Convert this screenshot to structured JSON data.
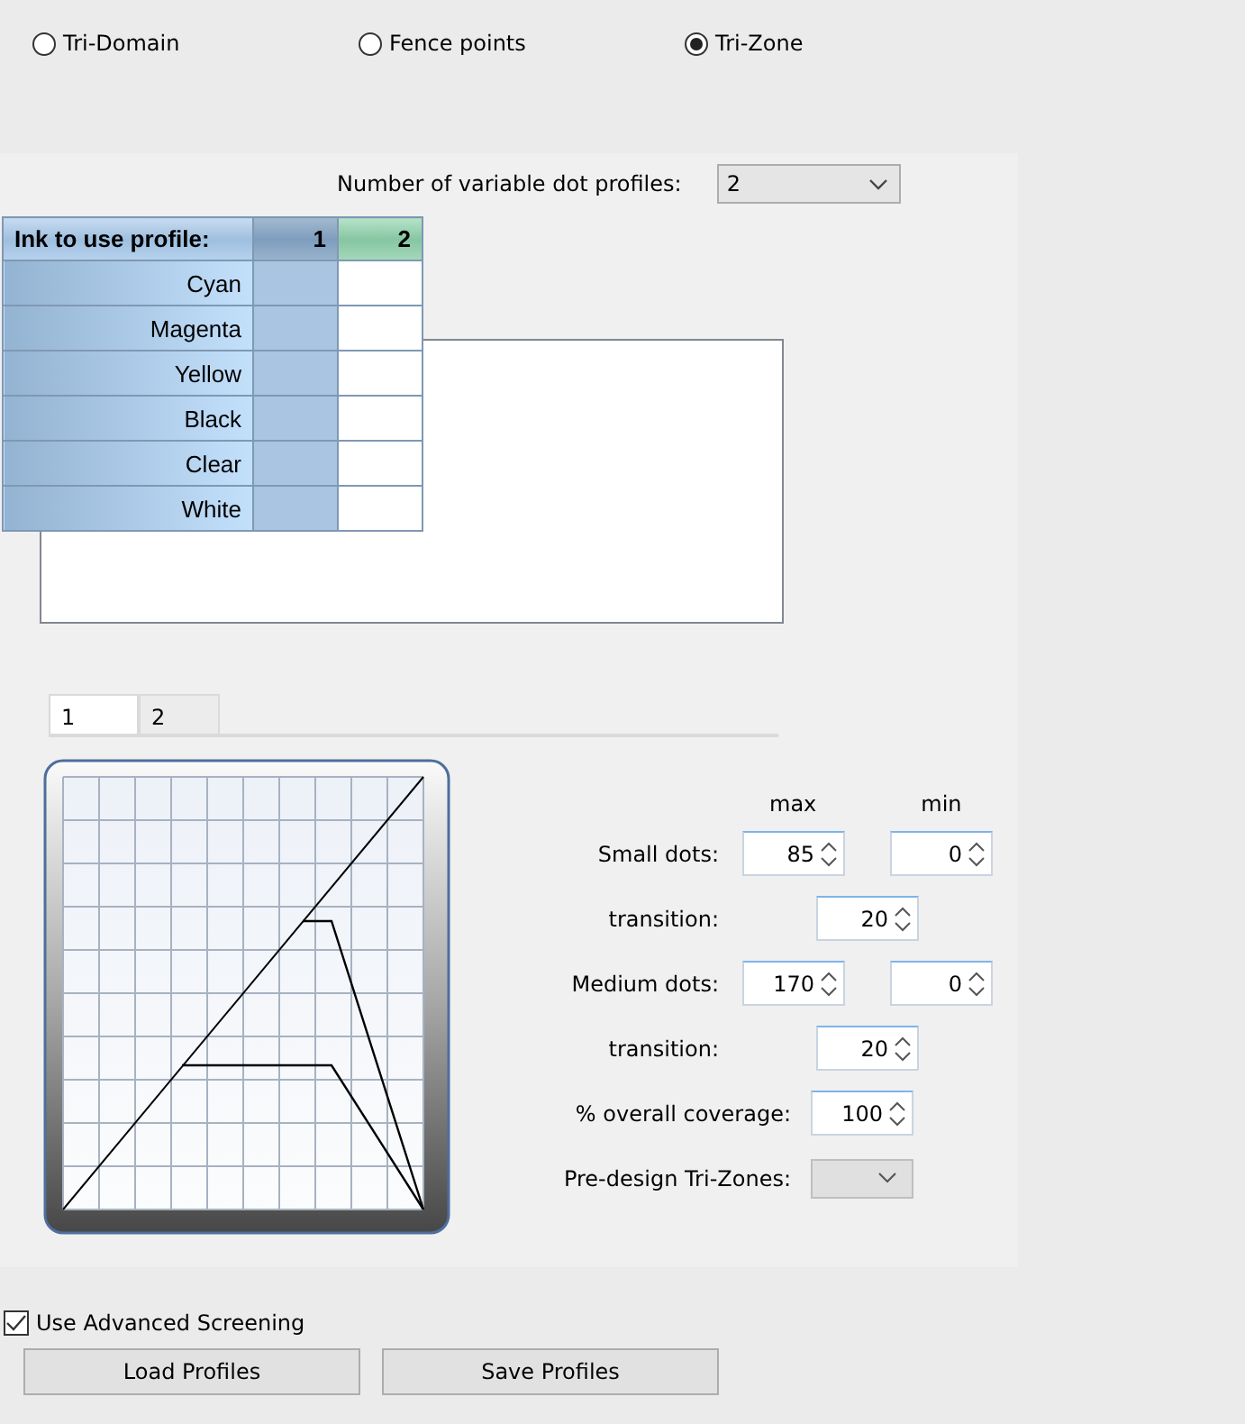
{
  "modes": [
    {
      "label": "Tri-Domain",
      "selected": false
    },
    {
      "label": "Fence points",
      "selected": false
    },
    {
      "label": "Tri-Zone",
      "selected": true
    }
  ],
  "profile_count": {
    "label": "Number of variable dot profiles:",
    "value": "2"
  },
  "ink_table": {
    "header": "Ink to use profile:",
    "columns": [
      {
        "label": "1",
        "selected": false
      },
      {
        "label": "2",
        "selected": true
      }
    ],
    "rows": [
      {
        "ink": "Cyan",
        "cells": [
          {
            "checked": true
          },
          {
            "checked": false
          }
        ]
      },
      {
        "ink": "Magenta",
        "cells": [
          {
            "checked": true
          },
          {
            "checked": false
          }
        ]
      },
      {
        "ink": "Yellow",
        "cells": [
          {
            "checked": true
          },
          {
            "checked": false
          }
        ]
      },
      {
        "ink": "Black",
        "cells": [
          {
            "checked": true
          },
          {
            "checked": false
          }
        ]
      },
      {
        "ink": "Clear",
        "cells": [
          {
            "checked": true
          },
          {
            "checked": false
          }
        ]
      },
      {
        "ink": "White",
        "cells": [
          {
            "checked": true
          },
          {
            "checked": false
          }
        ]
      }
    ]
  },
  "profile_tabs": [
    {
      "label": "1",
      "selected": true
    },
    {
      "label": "2",
      "selected": false
    }
  ],
  "settings": {
    "headers": [
      "max",
      "min"
    ],
    "rows": [
      {
        "kind": "pair",
        "label": "Small dots:",
        "values": [
          "85",
          "0"
        ]
      },
      {
        "kind": "single",
        "label": "transition:",
        "values": [
          "20"
        ]
      },
      {
        "kind": "pair",
        "label": "Medium dots:",
        "values": [
          "170",
          "0"
        ]
      },
      {
        "kind": "single",
        "label": "transition:",
        "values": [
          "20"
        ]
      },
      {
        "kind": "wide",
        "label": "% overall coverage:",
        "values": [
          "100"
        ]
      },
      {
        "kind": "select",
        "label": "Pre-design Tri-Zones:",
        "disabled": true
      }
    ]
  },
  "advanced_screening": {
    "label": "Use Advanced Screening",
    "checked": true
  },
  "buttons": [
    "Load Profiles",
    "Save Profiles"
  ]
}
